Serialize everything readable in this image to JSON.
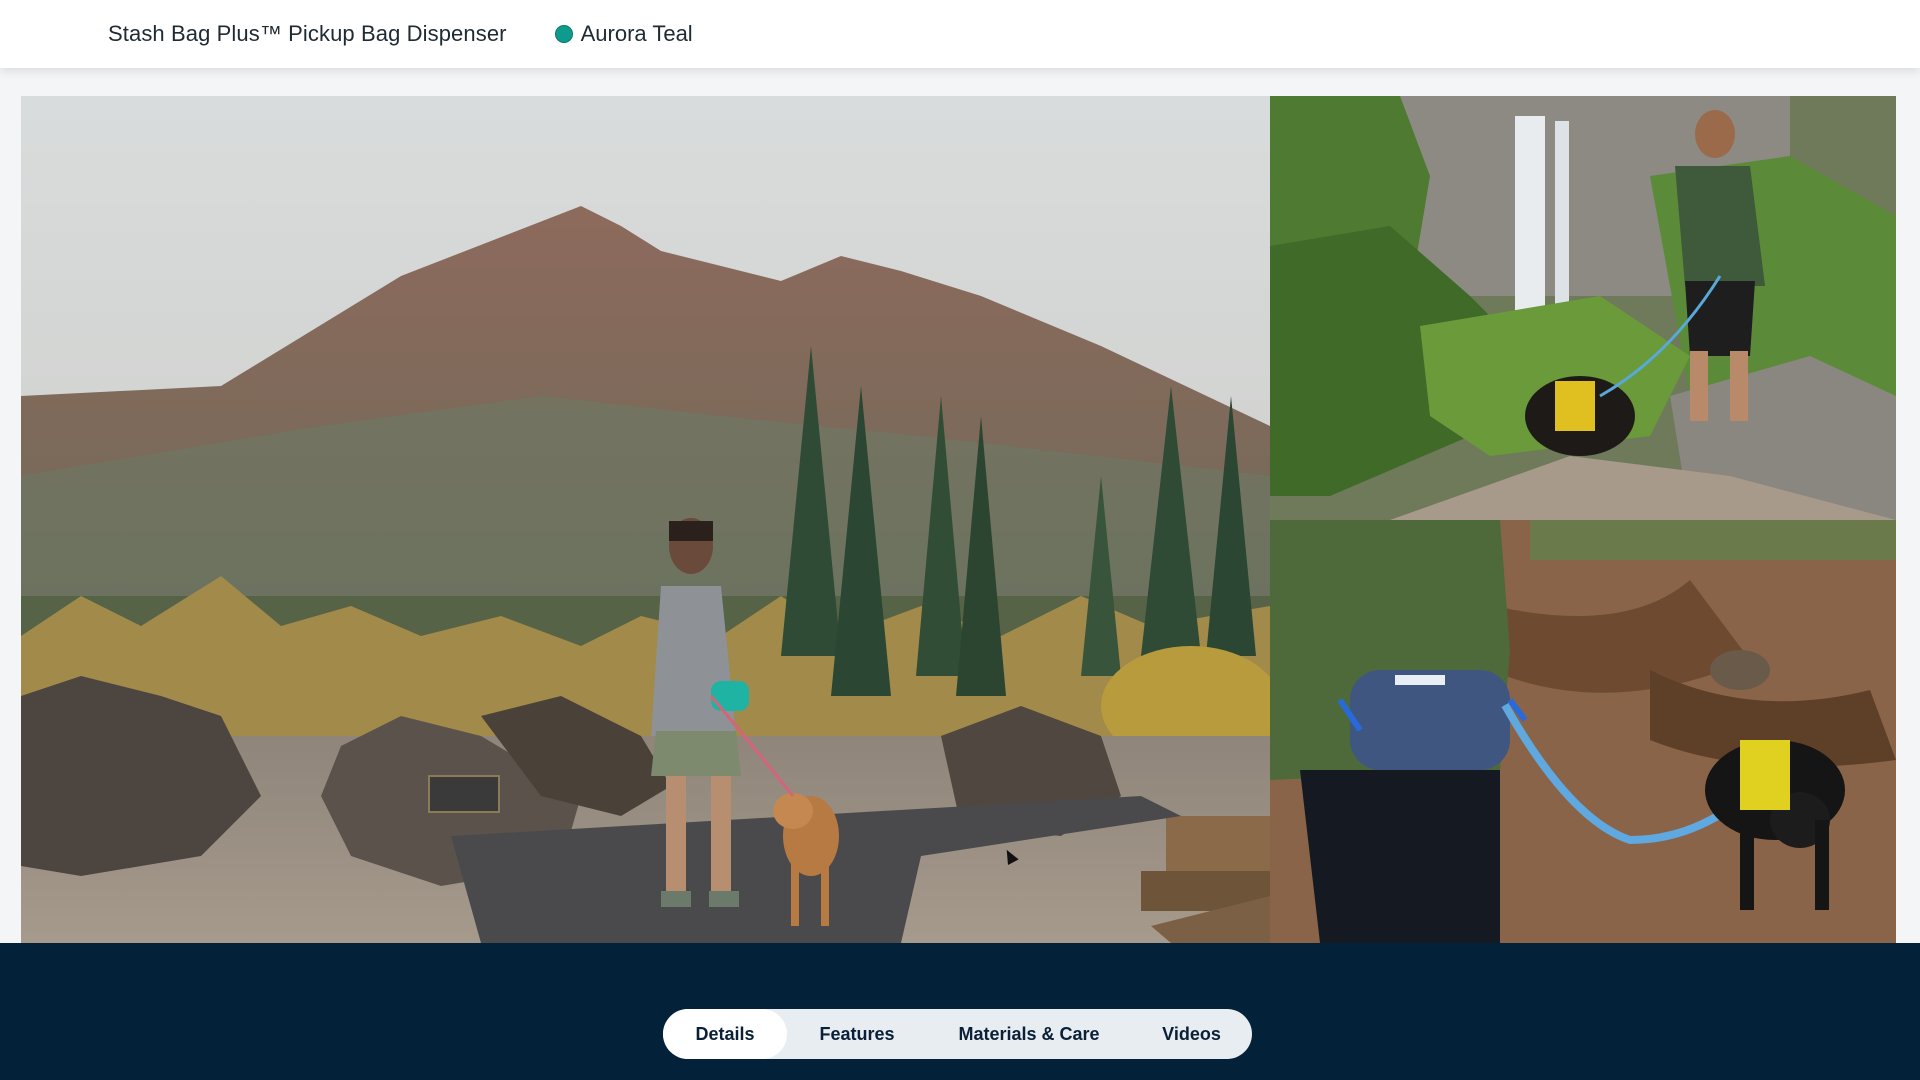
{
  "header": {
    "product_title": "Stash Bag Plus™ Pickup Bag Dispenser",
    "selected_color": {
      "name": "Aurora Teal",
      "hex": "#0f9a8e"
    }
  },
  "gallery": {
    "images": [
      {
        "name": "main-hiking-photo",
        "subject": "woman walking dog on trail with mountain"
      },
      {
        "name": "waterfall-hiking-photo",
        "subject": "man hiking with dog near waterfall"
      },
      {
        "name": "bag-closeup-photo",
        "subject": "waist bag closeup with pug on leash"
      }
    ]
  },
  "tabs": {
    "items": [
      {
        "label": "Details",
        "active": true
      },
      {
        "label": "Features",
        "active": false
      },
      {
        "label": "Materials & Care",
        "active": false
      },
      {
        "label": "Videos",
        "active": false
      }
    ]
  },
  "colors": {
    "band": "#03223a",
    "accent": "#0f9a8e"
  }
}
